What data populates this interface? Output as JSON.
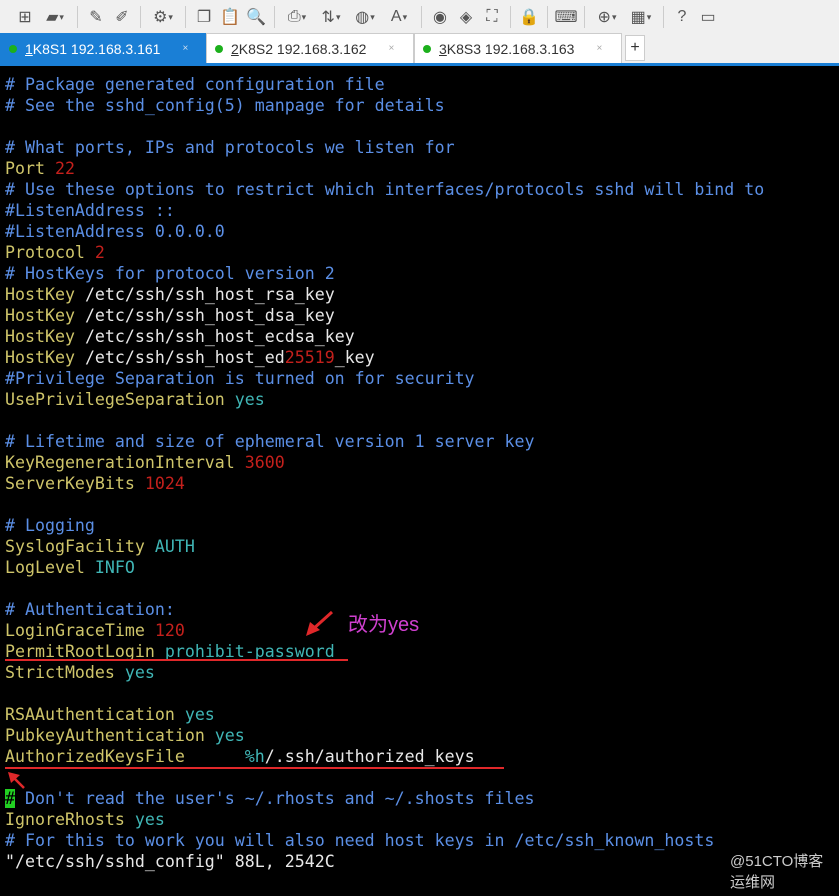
{
  "toolbar": {
    "icons": [
      "new-session-icon",
      "open-folder-icon",
      "connect-icon",
      "disconnect-icon",
      "session-settings-icon",
      "copy-icon",
      "paste-icon",
      "find-icon",
      "print-icon",
      "transfer-icon",
      "globe-icon",
      "font-icon",
      "xftp-icon",
      "xagent-icon",
      "fullscreen-icon",
      "lock-icon",
      "keyboard-icon",
      "new-tab-icon",
      "layout-icon",
      "help-icon",
      "chat-icon"
    ]
  },
  "tabs": [
    {
      "num": "1",
      "label": " K8S1 192.168.3.161",
      "active": true
    },
    {
      "num": "2",
      "label": " K8S2 192.168.3.162"
    },
    {
      "num": "3",
      "label": " K8S3 192.168.3.163"
    }
  ],
  "tab_close": "×",
  "tab_add": "+",
  "terminal": {
    "lines": [
      [
        [
          "# Package generated configuration file",
          "c"
        ]
      ],
      [
        [
          "# See the sshd_config(5) manpage for details",
          "c"
        ]
      ],
      [],
      [
        [
          "# What ports, IPs and protocols we listen for",
          "c"
        ]
      ],
      [
        [
          "Port ",
          "k"
        ],
        [
          "22",
          "n"
        ]
      ],
      [
        [
          "# Use these options to restrict which interfaces/protocols sshd will bind to",
          "c"
        ]
      ],
      [
        [
          "#ListenAddress ::",
          "c"
        ]
      ],
      [
        [
          "#ListenAddress 0.0.0.0",
          "c"
        ]
      ],
      [
        [
          "Protocol ",
          "k"
        ],
        [
          "2",
          "n"
        ]
      ],
      [
        [
          "# HostKeys for protocol version 2",
          "c"
        ]
      ],
      [
        [
          "HostKey ",
          "k"
        ],
        [
          "/etc/ssh/ssh_host_rsa_key",
          "w"
        ]
      ],
      [
        [
          "HostKey ",
          "k"
        ],
        [
          "/etc/ssh/ssh_host_dsa_key",
          "w"
        ]
      ],
      [
        [
          "HostKey ",
          "k"
        ],
        [
          "/etc/ssh/ssh_host_ecdsa_key",
          "w"
        ]
      ],
      [
        [
          "HostKey ",
          "k"
        ],
        [
          "/etc/ssh/ssh_host_ed",
          "w"
        ],
        [
          "25519",
          "n"
        ],
        [
          "_key",
          "w"
        ]
      ],
      [
        [
          "#Privilege Separation is turned on for security",
          "c"
        ]
      ],
      [
        [
          "UsePrivilegeSeparation ",
          "k"
        ],
        [
          "yes",
          "v"
        ]
      ],
      [],
      [
        [
          "# Lifetime and size of ephemeral version 1 server key",
          "c"
        ]
      ],
      [
        [
          "KeyRegenerationInterval ",
          "k"
        ],
        [
          "3600",
          "n"
        ]
      ],
      [
        [
          "ServerKeyBits ",
          "k"
        ],
        [
          "1024",
          "n"
        ]
      ],
      [],
      [
        [
          "# Logging",
          "c"
        ]
      ],
      [
        [
          "SyslogFacility ",
          "k"
        ],
        [
          "AUTH",
          "v"
        ]
      ],
      [
        [
          "LogLevel ",
          "k"
        ],
        [
          "INFO",
          "v"
        ]
      ],
      [],
      [
        [
          "# Authentication:",
          "c"
        ]
      ],
      [
        [
          "LoginGraceTime ",
          "k"
        ],
        [
          "120",
          "n"
        ]
      ],
      [
        [
          "PermitRootLogin ",
          "k"
        ],
        [
          "prohibit-password",
          "v"
        ]
      ],
      [
        [
          "StrictModes ",
          "k"
        ],
        [
          "yes",
          "v"
        ]
      ],
      [],
      [
        [
          "RSAAuthentication ",
          "k"
        ],
        [
          "yes",
          "v"
        ]
      ],
      [
        [
          "PubkeyAuthentication ",
          "k"
        ],
        [
          "yes",
          "v"
        ]
      ],
      [
        [
          "AuthorizedKeysFile      ",
          "k"
        ],
        [
          "%h",
          "v"
        ],
        [
          "/.ssh/authorized_keys",
          "w"
        ]
      ],
      [],
      [
        [
          "#",
          "cur"
        ],
        [
          " Don't read the user's ~/.rhosts and ~/.shosts files",
          "c"
        ]
      ],
      [
        [
          "IgnoreRhosts ",
          "k"
        ],
        [
          "yes",
          "v"
        ]
      ],
      [
        [
          "# For this to work you will also need host keys in /etc/ssh_known_hosts",
          "c"
        ]
      ],
      [
        [
          "\"/etc/ssh/sshd_config\" 88L, 2542C",
          "w"
        ]
      ]
    ]
  },
  "annotation": {
    "note": "改为yes",
    "color": "#e0282a"
  },
  "watermark": "@51CTO博客 运维网"
}
